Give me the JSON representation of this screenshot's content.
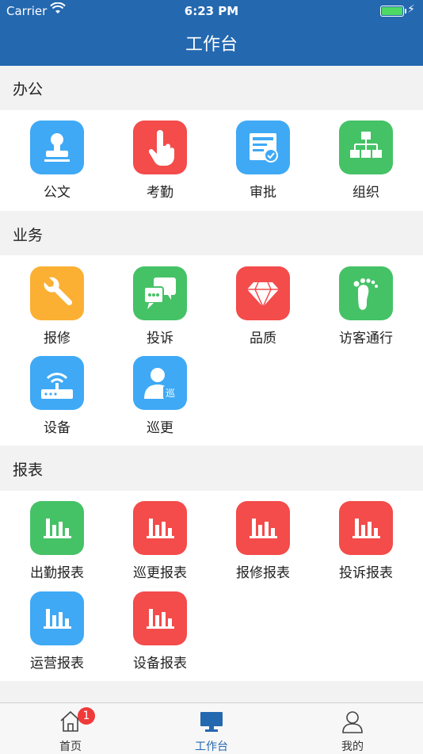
{
  "status_bar": {
    "carrier": "Carrier",
    "time": "6:23 PM"
  },
  "header": {
    "title": "工作台"
  },
  "colors": {
    "header": "#2468b0",
    "blue": "#3fa9f5",
    "red": "#f44b4b",
    "green": "#45c266",
    "orange": "#fbb034"
  },
  "sections": [
    {
      "title": "办公",
      "items": [
        {
          "label": "公文",
          "icon": "stamp-icon",
          "color": "#3fa9f5"
        },
        {
          "label": "考勤",
          "icon": "touch-icon",
          "color": "#f44b4b"
        },
        {
          "label": "审批",
          "icon": "approval-icon",
          "color": "#3fa9f5"
        },
        {
          "label": "组织",
          "icon": "org-chart-icon",
          "color": "#45c266"
        }
      ]
    },
    {
      "title": "业务",
      "items": [
        {
          "label": "报修",
          "icon": "wrench-icon",
          "color": "#fbb034"
        },
        {
          "label": "投诉",
          "icon": "chat-icon",
          "color": "#45c266"
        },
        {
          "label": "品质",
          "icon": "diamond-icon",
          "color": "#f44b4b"
        },
        {
          "label": "访客通行",
          "icon": "footprint-icon",
          "color": "#45c266"
        },
        {
          "label": "设备",
          "icon": "router-icon",
          "color": "#3fa9f5"
        },
        {
          "label": "巡更",
          "icon": "patrol-icon",
          "color": "#3fa9f5",
          "glyph": "巡"
        }
      ]
    },
    {
      "title": "报表",
      "items": [
        {
          "label": "出勤报表",
          "icon": "bar-chart-icon",
          "color": "#45c266"
        },
        {
          "label": "巡更报表",
          "icon": "bar-chart-icon",
          "color": "#f44b4b"
        },
        {
          "label": "报修报表",
          "icon": "bar-chart-icon",
          "color": "#f44b4b"
        },
        {
          "label": "投诉报表",
          "icon": "bar-chart-icon",
          "color": "#f44b4b"
        },
        {
          "label": "运营报表",
          "icon": "bar-chart-icon",
          "color": "#3fa9f5"
        },
        {
          "label": "设备报表",
          "icon": "bar-chart-icon",
          "color": "#f44b4b"
        }
      ]
    }
  ],
  "tabbar": {
    "home": {
      "label": "首页",
      "badge": "1"
    },
    "workbench": {
      "label": "工作台"
    },
    "mine": {
      "label": "我的"
    }
  }
}
